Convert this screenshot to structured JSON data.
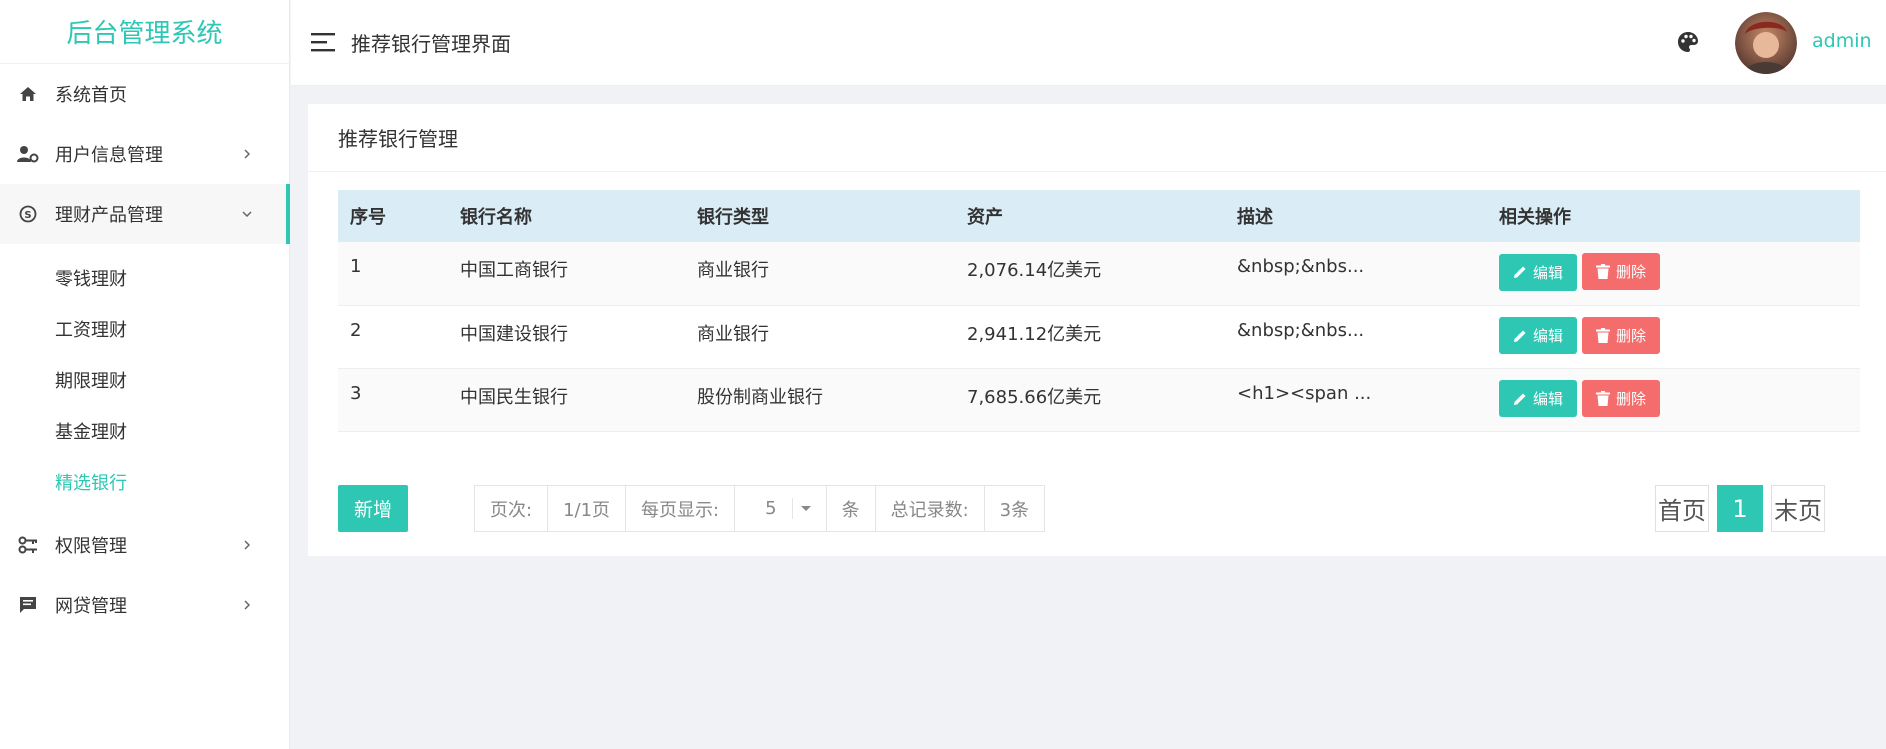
{
  "app": {
    "title": "后台管理系统"
  },
  "sidebar": {
    "items": [
      {
        "label": "系统首页",
        "icon": "home-icon"
      },
      {
        "label": "用户信息管理",
        "icon": "user-settings-icon"
      },
      {
        "label": "理财产品管理",
        "icon": "skype-icon"
      },
      {
        "label": "权限管理",
        "icon": "key-icon"
      },
      {
        "label": "网贷管理",
        "icon": "message-icon"
      }
    ],
    "submenu": [
      "零钱理财",
      "工资理财",
      "期限理财",
      "基金理财",
      "精选银行"
    ],
    "active_sub": "精选银行"
  },
  "header": {
    "title": "推荐银行管理界面",
    "user": "admin"
  },
  "card": {
    "title": "推荐银行管理"
  },
  "table": {
    "headers": [
      "序号",
      "银行名称",
      "银行类型",
      "资产",
      "描述",
      "相关操作"
    ],
    "rows": [
      {
        "id": "1",
        "name": "中国工商银行",
        "type": "商业银行",
        "assets": "2,076.14亿美元",
        "desc": "&nbsp;&nbs..."
      },
      {
        "id": "2",
        "name": "中国建设银行",
        "type": "商业银行",
        "assets": "2,941.12亿美元",
        "desc": "&nbsp;&nbs..."
      },
      {
        "id": "3",
        "name": "中国民生银行",
        "type": "股份制商业银行",
        "assets": "7,685.66亿美元",
        "desc": "<h1><span ..."
      }
    ],
    "edit_label": "编辑",
    "delete_label": "删除"
  },
  "footer": {
    "add_label": "新增",
    "page_label": "页次:",
    "page_value": "1/1页",
    "per_page_label": "每页显示:",
    "per_page_value": "5",
    "unit": "条",
    "total_label": "总记录数:",
    "total_value": "3条",
    "first": "首页",
    "current": "1",
    "last": "末页"
  },
  "colors": {
    "accent": "#2ec7b4",
    "danger": "#f56c6c",
    "table_header": "#daedf7"
  }
}
